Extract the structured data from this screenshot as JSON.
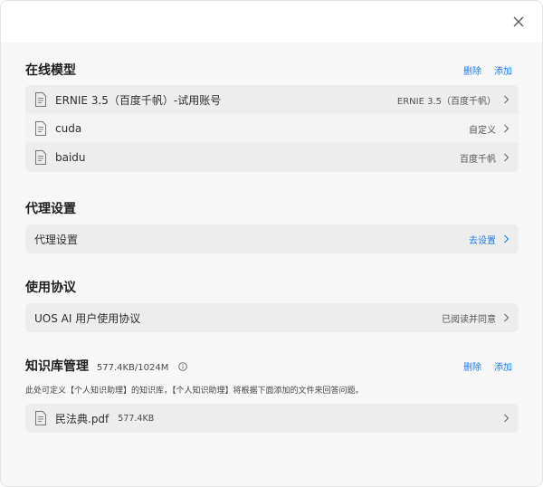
{
  "online_models": {
    "title": "在线模型",
    "delete_label": "删除",
    "add_label": "添加",
    "items": [
      {
        "name": "ERNIE 3.5（百度千帆）-试用账号",
        "value": "ERNIE 3.5（百度千帆）"
      },
      {
        "name": "cuda",
        "value": "自定义"
      },
      {
        "name": "baidu",
        "value": "百度千帆"
      }
    ]
  },
  "proxy": {
    "title": "代理设置",
    "row_label": "代理设置",
    "action": "去设置"
  },
  "agreement": {
    "title": "使用协议",
    "row_label": "UOS AI 用户使用协议",
    "status": "已阅读并同意"
  },
  "knowledge_base": {
    "title": "知识库管理",
    "storage": "577.4KB/1024M",
    "delete_label": "删除",
    "add_label": "添加",
    "description": "此处可定义【个人知识助理】的知识库，【个人知识助理】将根据下面添加的文件来回答问题。",
    "files": [
      {
        "name": "民法典.pdf",
        "size": "577.4KB"
      }
    ]
  },
  "icons": {
    "close": "close-icon",
    "file": "file-icon",
    "chevron": "chevron-right-icon",
    "info": "info-icon"
  },
  "colors": {
    "accent": "#1e7be8"
  }
}
